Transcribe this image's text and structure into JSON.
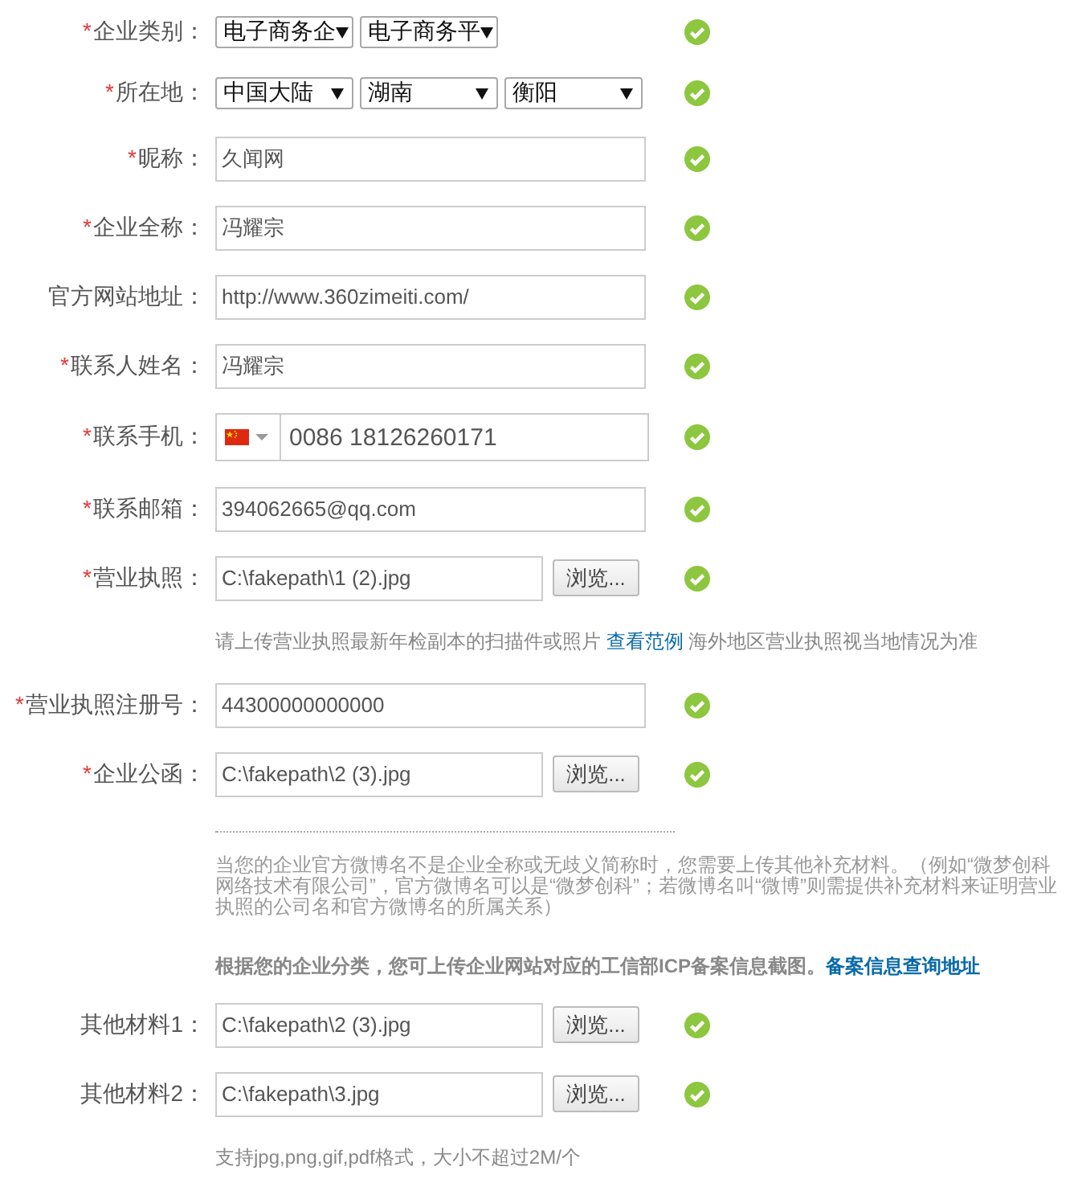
{
  "items": [
    {
      "kind": "select",
      "marker": "*",
      "label": "企业类别：",
      "valid": true,
      "selects": [
        "电子商务企",
        "电子商务平"
      ]
    },
    {
      "kind": "select",
      "marker": "*",
      "label": "所在地：",
      "valid": true,
      "selects": [
        "中国大陆",
        "湖南",
        "衡阳"
      ]
    },
    {
      "kind": "text",
      "marker": "*",
      "label": "昵称：",
      "valid": true,
      "value": "久闻网"
    },
    {
      "kind": "text",
      "marker": "*",
      "label": "企业全称：",
      "valid": true,
      "value": "冯耀宗"
    },
    {
      "kind": "text",
      "label": "官方网站地址：",
      "valid": true,
      "value": "http://www.360zimeiti.com/"
    },
    {
      "kind": "text",
      "marker": "*",
      "label": "联系人姓名：",
      "valid": true,
      "value": "冯耀宗"
    },
    {
      "kind": "phone",
      "marker": "*",
      "label": "联系手机：",
      "valid": true,
      "value": "0086 18126260171"
    },
    {
      "kind": "text",
      "marker": "*",
      "label": "联系邮箱：",
      "valid": true,
      "value": "394062665@qq.com"
    },
    {
      "kind": "file",
      "marker": "*",
      "label": "营业执照：",
      "valid": true,
      "value": "C:\\fakepath\\1 (2).jpg",
      "button": "浏览..."
    },
    {
      "kind": "note",
      "text": "请上传营业执照最新年检副本的扫描件或照片",
      "link": "查看范例",
      "text_after": "海外地区营业执照视当地情况为准"
    },
    {
      "kind": "text",
      "marker": "*",
      "label": "营业执照注册号：",
      "valid": true,
      "value": "44300000000000"
    },
    {
      "kind": "file",
      "marker": "*",
      "label": "企业公函：",
      "valid": true,
      "value": "C:\\fakepath\\2 (3).jpg",
      "button": "浏览..."
    },
    {
      "kind": "divider"
    },
    {
      "kind": "paragraph",
      "text": "当您的企业官方微博名不是企业全称或无歧义简称时，您需要上传其他补充材料。（例如“微梦创科网络技术有限公司”，官方微博名可以是“微梦创科”；若微博名叫“微博”则需提供补充材料来证明营业执照的公司名和官方微博名的所属关系）"
    },
    {
      "kind": "notice",
      "text": "根据您的企业分类，您可上传企业网站对应的工信部ICP备案信息截图。",
      "link": "备案信息查询地址"
    },
    {
      "kind": "file",
      "label": "其他材料1：",
      "valid": true,
      "value": "C:\\fakepath\\2 (3).jpg",
      "button": "浏览..."
    },
    {
      "kind": "file",
      "label": "其他材料2：",
      "valid": true,
      "value": "C:\\fakepath\\3.jpg",
      "button": "浏览..."
    },
    {
      "kind": "note",
      "text": "支持jpg,png,gif,pdf格式，大小不超过2M/个"
    }
  ]
}
